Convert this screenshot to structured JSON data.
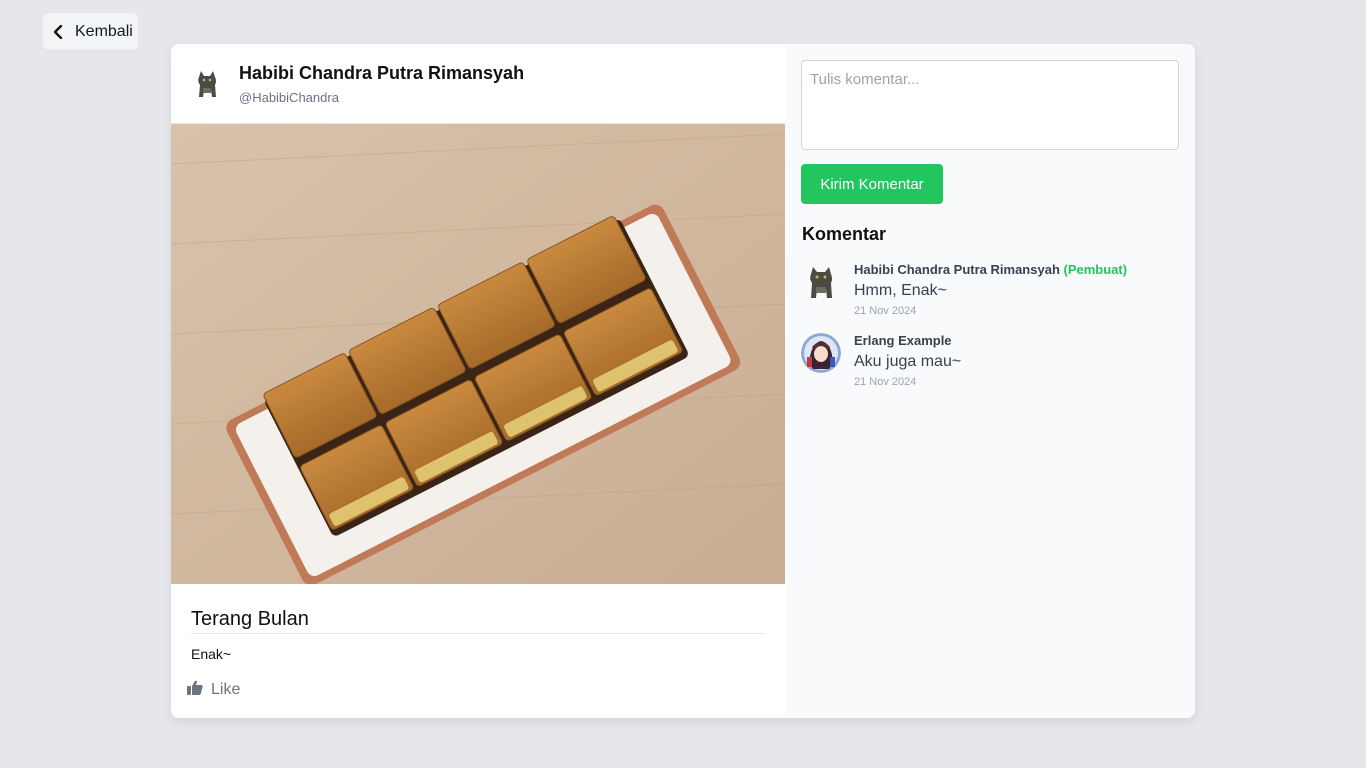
{
  "nav": {
    "back_label": "Kembali"
  },
  "post": {
    "author_name": "Habibi Chandra Putra Rimansyah",
    "author_handle": "@HabibiChandra",
    "title": "Terang Bulan",
    "description": "Enak~",
    "like_label": "Like"
  },
  "comment_form": {
    "placeholder": "Tulis komentar...",
    "submit_label": "Kirim Komentar"
  },
  "comments": {
    "heading": "Komentar",
    "items": [
      {
        "name": "Habibi Chandra Putra Rimansyah",
        "badge": "(Pembuat)",
        "text": "Hmm, Enak~",
        "date": "21 Nov 2024"
      },
      {
        "name": "Erlang Example",
        "badge": "",
        "text": "Aku juga mau~",
        "date": "21 Nov 2024"
      }
    ]
  },
  "colors": {
    "accent": "#22c55e",
    "background": "#e5e7eb"
  }
}
